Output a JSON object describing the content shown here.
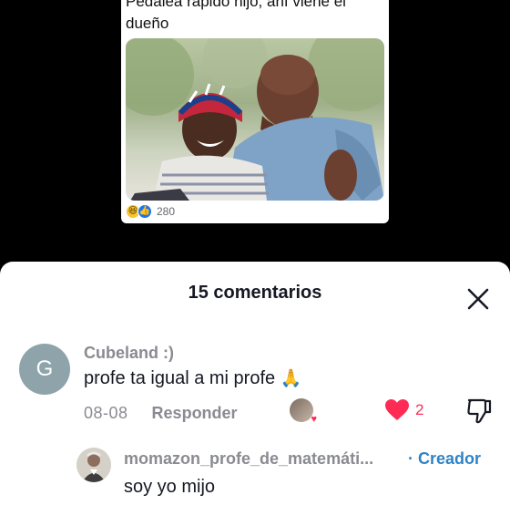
{
  "post": {
    "text_line1": "Pedalea rápido hijo, ahí viene el",
    "text_line2": "dueño",
    "reactions": {
      "laugh_icon": "😆",
      "like_icon": "👍",
      "count": "280"
    }
  },
  "comments_sheet": {
    "title": "15 comentarios",
    "close_icon": "close-x",
    "comment": {
      "avatar_letter": "G",
      "username": "Cubeland :)",
      "text": "profe ta igual a mi profe",
      "emoji": "🙏",
      "date": "08-08",
      "reply_label": "Responder",
      "likes": "2"
    },
    "reply": {
      "username": "momazon_profe_de_matemáti...",
      "creator_label": "· Creador",
      "text": "soy yo mijo"
    }
  },
  "colors": {
    "like_red": "#fe2c55",
    "creator_blue": "#2f83c5",
    "muted_gray": "#8a8b91",
    "avatar_bg": "#8ea3aa"
  }
}
